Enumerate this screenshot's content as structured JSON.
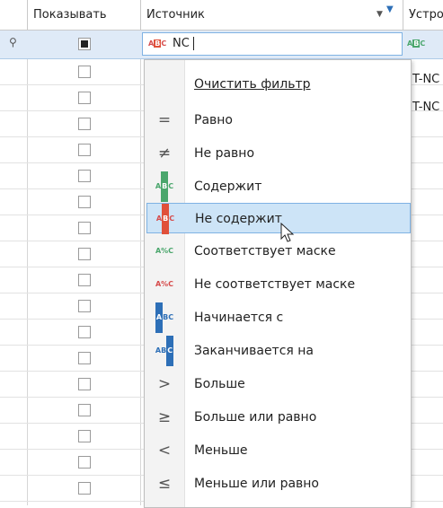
{
  "header": {
    "col_show": "Показывать",
    "col_source": "Источник",
    "col_device": "Устро"
  },
  "filter_row": {
    "pin_icon": "pin-icon",
    "show_checkbox": "filled",
    "source_value": "NC",
    "source_icon": "not-contains-icon",
    "device_icon": "contains-icon"
  },
  "rows": [
    {
      "device": "T-NC"
    },
    {
      "device": "T-NC"
    }
  ],
  "menu": {
    "clear": "Очистить фильтр",
    "items": [
      {
        "label": "Равно",
        "icon": "equals-icon"
      },
      {
        "label": "Не равно",
        "icon": "not-equals-icon"
      },
      {
        "label": "Содержит",
        "icon": "contains-icon"
      },
      {
        "label": "Не содержит",
        "icon": "not-contains-icon"
      },
      {
        "label": "Соответствует маске",
        "icon": "mask-icon"
      },
      {
        "label": "Не соответствует маске",
        "icon": "not-mask-icon"
      },
      {
        "label": "Начинается с",
        "icon": "begins-with-icon"
      },
      {
        "label": "Заканчивается на",
        "icon": "ends-with-icon"
      },
      {
        "label": "Больше",
        "icon": "greater-icon"
      },
      {
        "label": "Больше или равно",
        "icon": "greater-or-equal-icon"
      },
      {
        "label": "Меньше",
        "icon": "less-icon"
      },
      {
        "label": "Меньше или равно",
        "icon": "less-or-equal-icon"
      }
    ],
    "selected": "Не содержит"
  },
  "colors": {
    "selection": "#cde4f7",
    "filter_row": "#dfeaf7",
    "accent_blue": "#2d6fb7"
  }
}
